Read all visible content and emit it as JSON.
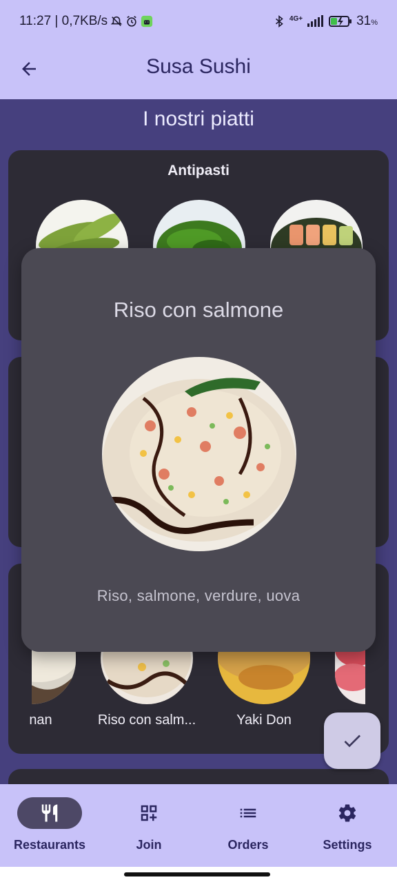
{
  "status_bar": {
    "time_network": "11:27 | 0,7KB/s",
    "network_type": "4G+",
    "battery_level": "31",
    "battery_unit": "%"
  },
  "app_bar": {
    "title": "Susa Sushi",
    "back_icon": "arrow-back-icon"
  },
  "menu": {
    "heading": "I nostri piatti",
    "sections": [
      {
        "title": "Antipasti"
      }
    ],
    "visible_dishes": [
      {
        "label": "..."
      },
      {
        "label": "Riso con salm..."
      },
      {
        "label": "Yaki Don"
      }
    ],
    "partial_label_left": "nan"
  },
  "dialog": {
    "title": "Riso con salmone",
    "description": "Riso, salmone, verdure, uova"
  },
  "fab": {
    "icon": "check-icon"
  },
  "bottom_nav": {
    "items": [
      {
        "label": "Restaurants",
        "icon": "restaurant-icon",
        "active": true
      },
      {
        "label": "Join",
        "icon": "qr-code-icon",
        "active": false
      },
      {
        "label": "Orders",
        "icon": "list-icon",
        "active": false
      },
      {
        "label": "Settings",
        "icon": "settings-icon",
        "active": false
      }
    ]
  },
  "colors": {
    "accent_bar": "#c8c2f9",
    "page_background": "#46407e",
    "card_background": "#2d2b35",
    "dialog_background": "#4b4953"
  }
}
